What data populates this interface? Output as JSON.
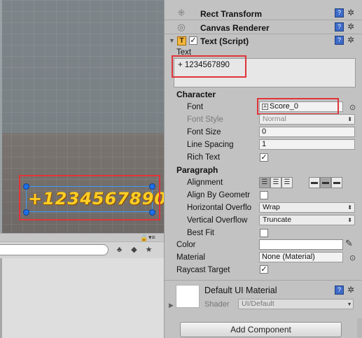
{
  "scene": {
    "text_display": "+1234567890"
  },
  "project_toolbar": {
    "lock_icon": "lock-icon",
    "menu_icon": "menu-icon",
    "search_placeholder": "",
    "filter_type_icon": "shapes-icon",
    "filter_label_icon": "tag-icon",
    "favorites_icon": "star-icon"
  },
  "inspector": {
    "components": {
      "rect_transform": "Rect Transform",
      "canvas_renderer": "Canvas Renderer",
      "text_script": "Text (Script)"
    },
    "text_label": "Text",
    "text_value": "+ 1234567890",
    "character_header": "Character",
    "font_label": "Font",
    "font_value": "Score_0",
    "font_style_label": "Font Style",
    "font_style_value": "Normal",
    "font_size_label": "Font Size",
    "font_size_value": "0",
    "line_spacing_label": "Line Spacing",
    "line_spacing_value": "1",
    "rich_text_label": "Rich Text",
    "paragraph_header": "Paragraph",
    "alignment_label": "Alignment",
    "align_by_geometry_label": "Align By Geometr",
    "horizontal_overflow_label": "Horizontal Overflo",
    "horizontal_overflow_value": "Wrap",
    "vertical_overflow_label": "Vertical Overflow",
    "vertical_overflow_value": "Truncate",
    "best_fit_label": "Best Fit",
    "color_label": "Color",
    "material_label": "Material",
    "material_value": "None (Material)",
    "raycast_target_label": "Raycast Target",
    "default_material_name": "Default UI Material",
    "shader_label": "Shader",
    "shader_value": "UI/Default",
    "add_component_label": "Add Component"
  },
  "colors": {
    "highlight": "#e0343a",
    "scene_text": "#ffcf25",
    "selection_handle": "#1d6fe8"
  }
}
